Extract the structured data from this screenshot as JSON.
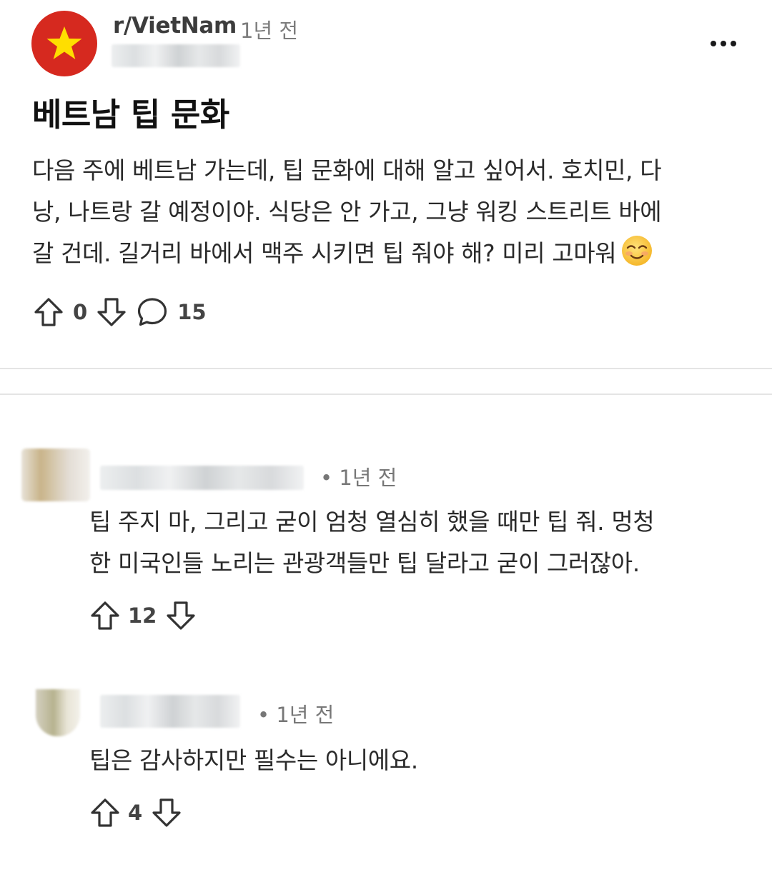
{
  "post": {
    "subreddit": "r/VietNam",
    "time": "1년 전",
    "title": "베트남 팁 문화",
    "body_lines": [
      "다음 주에 베트남 가는데, 팁 문화에 대해 알고 싶어서. 호치민, 다",
      "낭, 나트랑 갈 예정이야. 식당은 안 가고, 그냥 워킹 스트리트 바에",
      "갈 건데. 길거리 바에서 맥주 시키면 팁 줘야 해? 미리 고마워"
    ],
    "votes": "0",
    "comments_count": "15"
  },
  "comments": [
    {
      "time": "• 1년 전",
      "lines": [
        "팁 주지 마, 그리고 굳이 엄청 열심히 했을 때만 팁 줘. 멍청",
        "한 미국인들 노리는 관광객들만 팁 달라고 굳이 그러잖아."
      ],
      "votes": "12"
    },
    {
      "time": "• 1년 전",
      "lines": [
        "팁은 감사하지만 필수는 아니에요."
      ],
      "votes": "4"
    }
  ],
  "icons": {
    "subreddit_avatar": "vietnam-flag-star-icon",
    "upvote": "arrow-up-outline-icon",
    "downvote": "arrow-down-outline-icon",
    "comment": "speech-bubble-icon",
    "more": "three-dots-icon",
    "emoji": "smiling-face-emoji"
  },
  "colors": {
    "flag_red": "#d6291f",
    "flag_star": "#ffde00",
    "text": "#2a2a2a",
    "meta": "#777777"
  }
}
